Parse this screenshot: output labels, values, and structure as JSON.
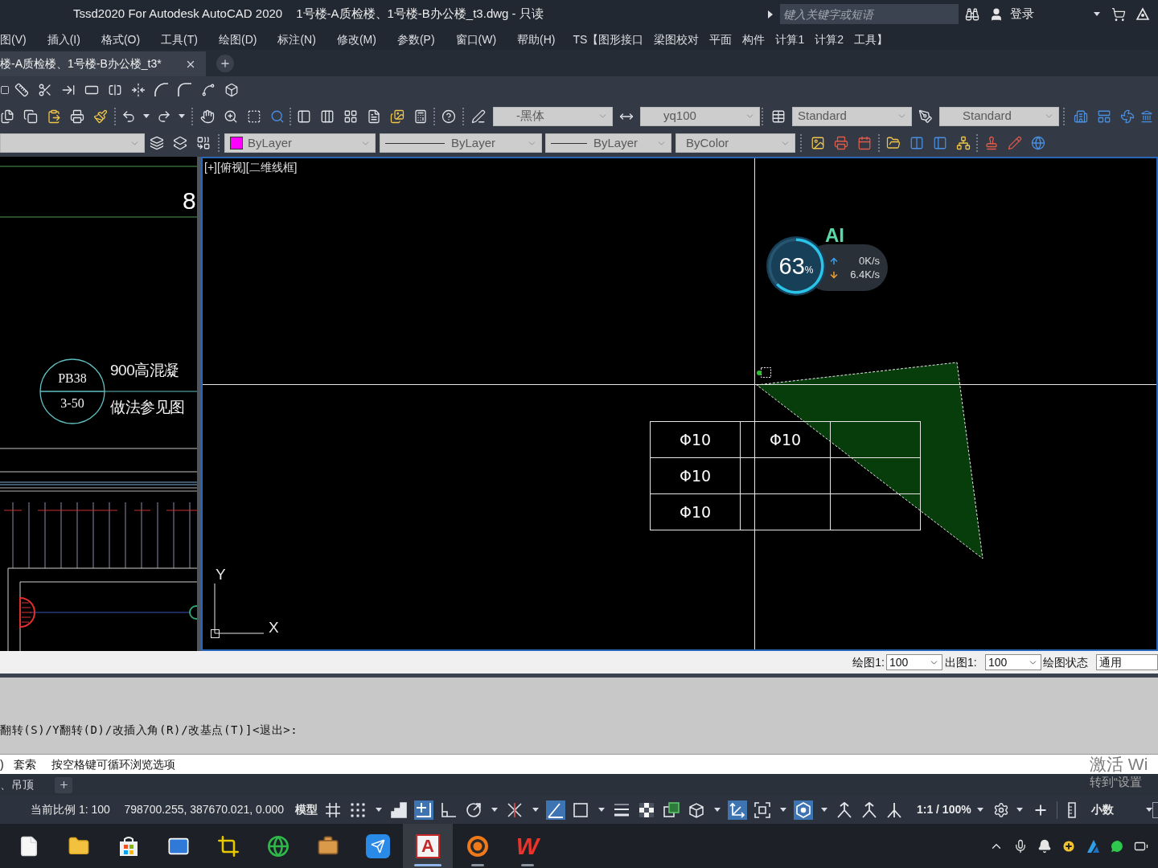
{
  "title_bar": {
    "app_title": "Tssd2020 For Autodesk AutoCAD 2020",
    "document_title": "1号楼-A质检楼、1号楼-B办公楼_t3.dwg - 只读",
    "search": {
      "placeholder": "键入关键字或短语"
    },
    "sign_in": "登录"
  },
  "menu": [
    "图(V)",
    "插入(I)",
    "格式(O)",
    "工具(T)",
    "绘图(D)",
    "标注(N)",
    "修改(M)",
    "参数(P)",
    "窗口(W)",
    "帮助(H)"
  ],
  "tssd_menu": [
    "TS【图形接口",
    "梁图校对",
    "平面",
    "构件",
    "计算1",
    "计算2",
    "工具】"
  ],
  "document_tabs": [
    {
      "label": "楼-A质检楼、1号楼-B办公楼_t3*",
      "selected": true
    }
  ],
  "style_combos": [
    {
      "kind": "text_style",
      "value": "-黑体"
    },
    {
      "kind": "dim_style",
      "value": "yq100"
    },
    {
      "kind": "table_style",
      "value": "Standard"
    },
    {
      "kind": "mleader_style",
      "value": "Standard"
    }
  ],
  "property_combos": [
    {
      "kind": "color",
      "value": "ByLayer",
      "color": "#ff00ff"
    },
    {
      "kind": "linetype",
      "value": "ByLayer"
    },
    {
      "kind": "lineweight",
      "value": "ByLayer"
    },
    {
      "kind": "plot_style",
      "value": "ByColor"
    }
  ],
  "side_drawing": {
    "number": "8",
    "tag_top": "PB38",
    "tag_bottom": "3-50",
    "note_lines": [
      "900高混凝",
      "做法参见图"
    ]
  },
  "viewport": {
    "label": "[+][俯视][二维线框]",
    "table": {
      "rows": [
        [
          "Φ10",
          "Φ10"
        ],
        [
          "Φ10"
        ],
        [
          "Φ10"
        ]
      ]
    },
    "ucs": {
      "y_label": "Y",
      "x_label": "X"
    }
  },
  "monitor_widget": {
    "badge": "AI",
    "percent": "63",
    "percent_sign": "%",
    "chart_data": {
      "type": "donut",
      "values": [
        63,
        37
      ]
    },
    "upload": "0K/s",
    "download": "6.4K/s"
  },
  "scale_bar": {
    "draw_label": "绘图1:",
    "draw_scale": "100",
    "plot_label": "出图1:",
    "plot_scale": "100",
    "state_label": "绘图状态",
    "state": "通用"
  },
  "command_history": [
    "翻转(S)/Y翻转(D)/改插入角(R)/改基点(T)]<退出>:"
  ],
  "command_line": [
    ")",
    "套索",
    "按空格键可循环浏览选项"
  ],
  "layout_tabs": [
    {
      "label": "、吊顶",
      "selected": false
    }
  ],
  "activation_notice": [
    "激活 Wi",
    "转到“设置"
  ],
  "status_bar": {
    "scale": "当前比例 1: 100",
    "coordinates": "798700.255, 387670.021, 0.000",
    "space": "模型",
    "toggles": [
      {
        "kind": "grid",
        "on": false,
        "menu": false
      },
      {
        "kind": "snap",
        "on": false,
        "menu": true
      },
      {
        "kind": "infer",
        "on": false,
        "menu": false
      },
      {
        "kind": "dynamic_input",
        "on": true,
        "menu": false
      },
      {
        "kind": "ortho",
        "on": false,
        "menu": false
      },
      {
        "kind": "polar",
        "on": false,
        "menu": true
      },
      {
        "kind": "isodraft",
        "on": false,
        "menu": true
      },
      {
        "kind": "object_tracking",
        "on": true,
        "menu": false
      },
      {
        "kind": "object_snap",
        "on": false,
        "menu": true
      },
      {
        "kind": "lineweight",
        "on": false,
        "menu": false
      },
      {
        "kind": "transparency",
        "on": false,
        "menu": false
      },
      {
        "kind": "selection_cycling",
        "on": false,
        "menu": false
      },
      {
        "kind": "snap_3d",
        "on": false,
        "menu": true
      },
      {
        "kind": "dynamic_ucs",
        "on": true,
        "menu": false
      },
      {
        "kind": "selection_filter",
        "on": false,
        "menu": true
      },
      {
        "kind": "gizmo",
        "on": true,
        "menu": true
      },
      {
        "kind": "annotation_visibility",
        "on": false,
        "menu": false
      },
      {
        "kind": "auto_scale",
        "on": false,
        "menu": false
      },
      {
        "kind": "annotation_scale",
        "on": false,
        "menu": false
      }
    ],
    "annotation_scale": "1:1 / 100%",
    "units": "小数"
  },
  "taskbar": {
    "apps": [
      {
        "kind": "document",
        "running": false,
        "selected": false
      },
      {
        "kind": "folder",
        "running": false,
        "selected": false
      },
      {
        "kind": "store",
        "running": false,
        "selected": false
      },
      {
        "kind": "mail",
        "running": false,
        "selected": false
      },
      {
        "kind": "crop",
        "running": false,
        "selected": false
      },
      {
        "kind": "browser",
        "running": false,
        "selected": false
      },
      {
        "kind": "toolbox",
        "running": false,
        "selected": false
      },
      {
        "kind": "messenger",
        "running": false,
        "selected": false
      },
      {
        "kind": "cad",
        "logo": "A",
        "running": true,
        "selected": true
      },
      {
        "kind": "recorder",
        "running": true,
        "selected": false
      },
      {
        "kind": "office",
        "logo": "W",
        "running": true,
        "selected": false
      }
    ]
  }
}
